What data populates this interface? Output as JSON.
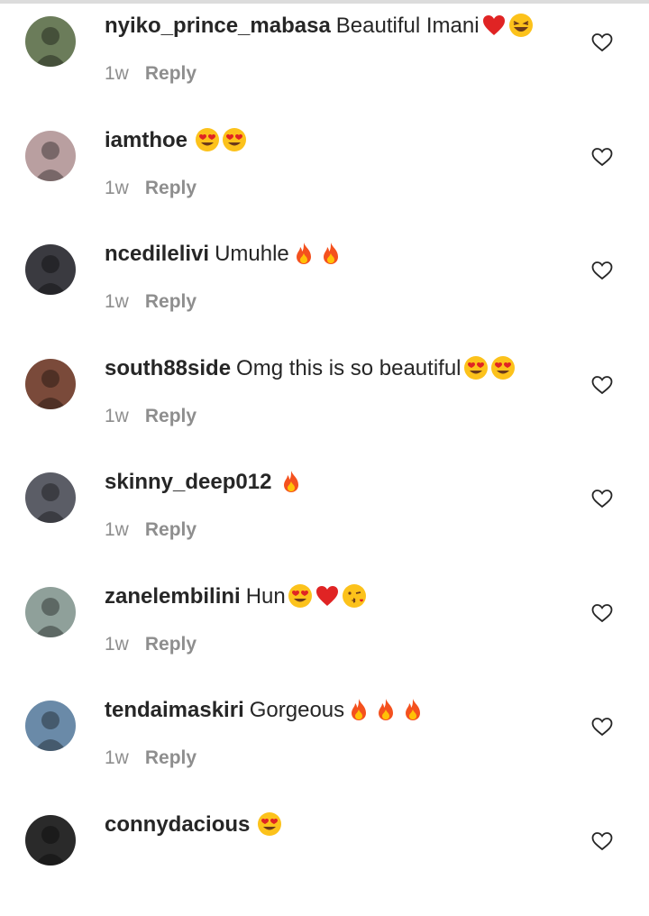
{
  "comments": [
    {
      "username": "nyiko_prince_mabasa",
      "text": "Beautiful Imani",
      "emojis": [
        "heart-emoji",
        "laughing-emoji"
      ],
      "time": "1w",
      "reply": "Reply",
      "avatar_color": "#6b7c5a"
    },
    {
      "username": "iamthoe",
      "text": "",
      "emojis": [
        "heart-eyes-emoji",
        "heart-eyes-emoji"
      ],
      "time": "1w",
      "reply": "Reply",
      "avatar_color": "#b99fa0"
    },
    {
      "username": "ncedilelivi",
      "text": "Umuhle",
      "emojis": [
        "fire-emoji",
        "fire-emoji"
      ],
      "time": "1w",
      "reply": "Reply",
      "avatar_color": "#3a3a40"
    },
    {
      "username": "south88side",
      "text": "Omg this is so beautiful",
      "emojis": [
        "heart-eyes-emoji",
        "heart-eyes-emoji"
      ],
      "time": "1w",
      "reply": "Reply",
      "avatar_color": "#7a4a3a"
    },
    {
      "username": "skinny_deep012",
      "text": "",
      "emojis": [
        "fire-emoji"
      ],
      "time": "1w",
      "reply": "Reply",
      "avatar_color": "#5b5d66"
    },
    {
      "username": "zanelembilini",
      "text": "Hun",
      "emojis": [
        "heart-eyes-emoji",
        "heart-emoji",
        "kiss-emoji"
      ],
      "time": "1w",
      "reply": "Reply",
      "avatar_color": "#8fa09a"
    },
    {
      "username": "tendaimaskiri",
      "text": "Gorgeous",
      "emojis": [
        "fire-emoji",
        "fire-emoji",
        "fire-emoji"
      ],
      "time": "1w",
      "reply": "Reply",
      "avatar_color": "#6a8aa8"
    },
    {
      "username": "connydacious",
      "text": "",
      "emojis": [
        "heart-eyes-emoji"
      ],
      "time": "",
      "reply": "",
      "avatar_color": "#2a2a2a"
    }
  ]
}
